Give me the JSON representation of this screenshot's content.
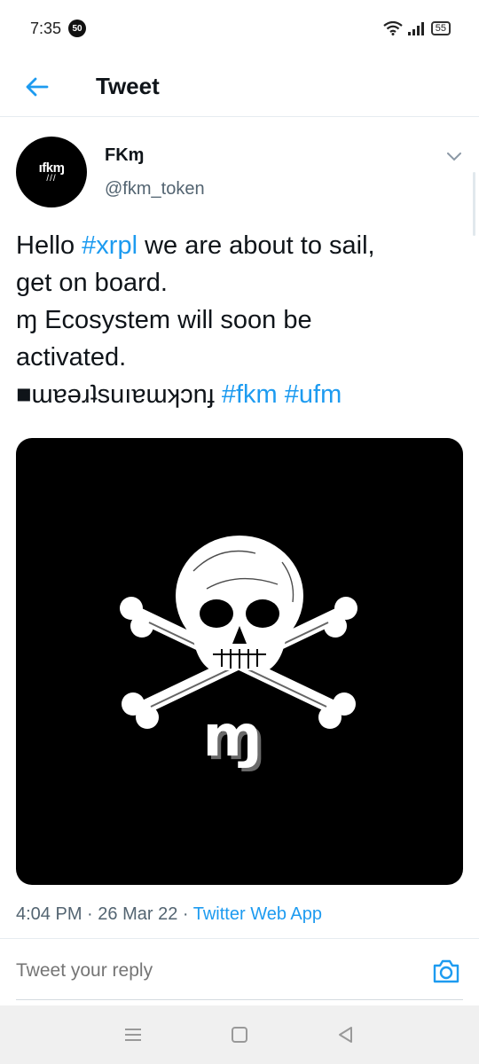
{
  "status_bar": {
    "time": "7:35",
    "notification_count": "50",
    "battery": "55"
  },
  "header": {
    "title": "Tweet"
  },
  "tweet": {
    "avatar_text": "ıfkɱ",
    "avatar_subtext": "///",
    "display_name": "FKɱ",
    "handle": "@fkm_token",
    "text_lines": [
      {
        "before": "Hello ",
        "tag": "#xrpl",
        "after": " we are about to sail,"
      },
      {
        "text": "get on board."
      },
      {
        "text": "ɱ Ecosystem will soon be"
      },
      {
        "text": "activated."
      },
      {
        "prefix": "■ɯɐǝɹʇsuıɐɯʞɔnɟ ",
        "tag1": "#fkm",
        "sep": " ",
        "tag2": "#ufm"
      }
    ],
    "media_glyph": "ɱ",
    "time": "4:04 PM",
    "date": "26 Mar 22",
    "source": "Twitter Web App"
  },
  "reply": {
    "placeholder": "Tweet your reply"
  },
  "icons": {
    "back": "arrow-left-icon",
    "caret": "chevron-down-icon",
    "camera": "camera-icon",
    "wifi": "wifi-icon",
    "signal": "signal-icon",
    "battery": "battery-icon",
    "nav_menu": "menu-icon",
    "nav_home": "square-icon",
    "nav_back": "triangle-back-icon"
  },
  "colors": {
    "accent": "#1d9bf0",
    "text_primary": "#0f1419",
    "text_secondary": "#536471"
  }
}
